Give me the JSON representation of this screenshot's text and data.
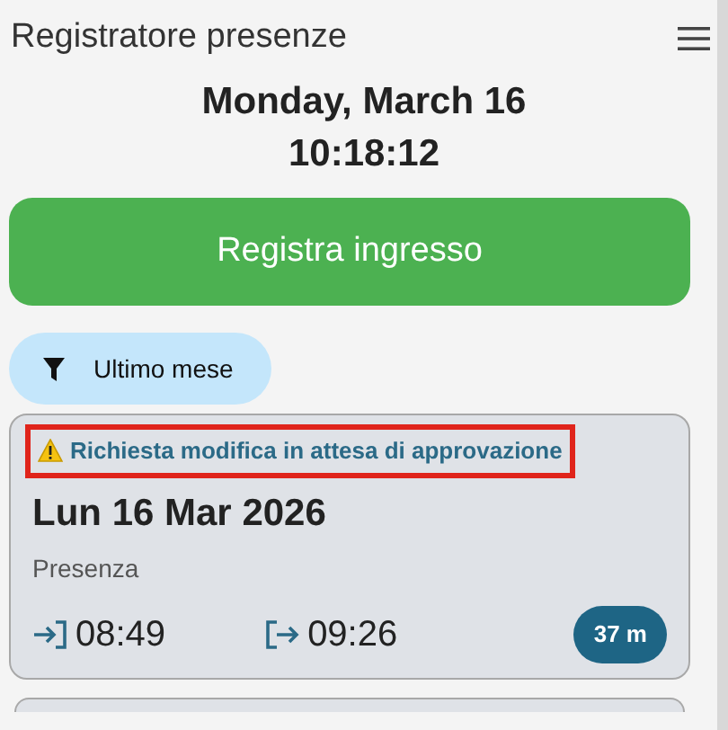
{
  "app_bar": {
    "title": "Registratore presenze"
  },
  "clock": {
    "date": "Monday, March 16",
    "time": "10:18:12"
  },
  "action_button": {
    "label": "Registra ingresso"
  },
  "filter_chip": {
    "label": "Ultimo mese"
  },
  "records": [
    {
      "notice": {
        "text": "Richiesta modifica in attesa di approvazione",
        "highlighted": true
      },
      "date": "Lun 16 Mar 2026",
      "type": "Presenza",
      "time_in": "08:49",
      "time_out": "09:26",
      "duration": "37 m"
    }
  ]
}
